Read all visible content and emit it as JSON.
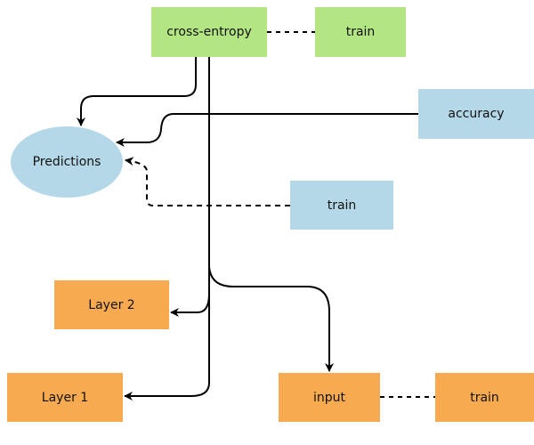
{
  "colors": {
    "green": "#b3e682",
    "blue": "#b4d8e7",
    "orange": "#f8aa50",
    "edge": "#000000"
  },
  "nodes": {
    "cross_entropy": "cross-entropy",
    "train_top": "train",
    "accuracy": "accuracy",
    "predictions": "Predictions",
    "train_mid": "train",
    "layer2": "Layer 2",
    "layer1": "Layer 1",
    "input": "input",
    "train_bottom": "train"
  },
  "edges": [
    {
      "from": "cross_entropy",
      "to": "train_top",
      "style": "dotted"
    },
    {
      "from": "cross_entropy",
      "to": "predictions",
      "style": "solid"
    },
    {
      "from": "accuracy",
      "to": "predictions",
      "style": "solid"
    },
    {
      "from": "train_mid",
      "to": "predictions",
      "style": "dashed"
    },
    {
      "from": "cross_entropy",
      "to": "layer2",
      "style": "solid"
    },
    {
      "from": "cross_entropy",
      "to": "layer1",
      "style": "solid"
    },
    {
      "from": "cross_entropy",
      "to": "input",
      "style": "solid"
    },
    {
      "from": "input",
      "to": "train_bottom",
      "style": "dotted"
    }
  ]
}
